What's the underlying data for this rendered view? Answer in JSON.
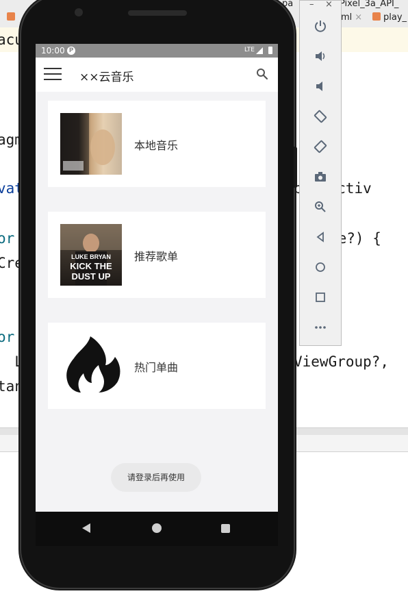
{
  "ide": {
    "tabs": [
      {
        "label": "pa",
        "close": ""
      },
      {
        "label": "Pixel_3a_API_",
        "close": ""
      },
      {
        "label": "ml",
        "close": "×"
      },
      {
        "label": "play_",
        "close": ""
      }
    ],
    "breadcrumb_fragment": "acu",
    "code_lines": [
      {
        "text": "agm"
      },
      {
        "text": "vat",
        "right": "pbatActiv"
      },
      {
        "text": "or",
        "right": "le?) {"
      },
      {
        "text": "Cre"
      },
      {
        "text": "or",
        "right": ""
      },
      {
        "text": "  L",
        "right": "ViewGroup?,"
      },
      {
        "text": "tan"
      }
    ]
  },
  "emulator_toolbar": {
    "minimize": "–",
    "close": "×",
    "buttons": [
      "power-icon",
      "volume-up-icon",
      "volume-down-icon",
      "rotate-left-icon",
      "rotate-right-icon",
      "camera-icon",
      "zoom-icon",
      "back-icon",
      "home-icon",
      "overview-icon",
      "more-icon"
    ]
  },
  "app": {
    "status_bar": {
      "time": "10:00",
      "network": "LTE"
    },
    "toolbar": {
      "title": "××云音乐"
    },
    "cards": [
      {
        "label": "本地音乐",
        "thumb": "album-cover-jay-chou"
      },
      {
        "label": "推荐歌单",
        "thumb": "album-cover-luke-bryan"
      },
      {
        "label": "热门单曲",
        "thumb": "flame-icon"
      }
    ],
    "album2_text": [
      "LUKE BRYAN",
      "KICK THE",
      "DUST UP"
    ],
    "toast": "请登录后再使用"
  },
  "colors": {
    "screen_bg": "#f3f3f5",
    "status_bar": "#8d8d8d",
    "card_bg": "#ffffff",
    "toast_bg": "#e9e9ea"
  }
}
